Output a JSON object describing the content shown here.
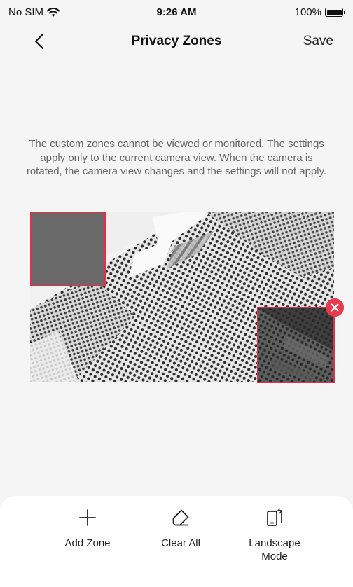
{
  "status_bar": {
    "carrier": "No SIM",
    "time": "9:26 AM",
    "battery": "100%",
    "battery_level": 1.0,
    "icons": [
      "wifi-icon",
      "battery-icon"
    ]
  },
  "nav": {
    "title": "Privacy Zones",
    "save_label": "Save",
    "back_icon": "chevron-left-icon"
  },
  "description": "The custom zones cannot be viewed or monitored. The settings apply only to the current camera view. When the camera is rotated, the camera view changes and the settings will not apply.",
  "camera": {
    "zones": [
      "privacy-zone-1",
      "privacy-zone-2"
    ],
    "delete_icon": "close-icon",
    "colors": {
      "zone_border": "#e0304b",
      "delete_button": "#e8394d"
    }
  },
  "actions": {
    "add_zone": {
      "label": "Add Zone",
      "icon": "plus-icon"
    },
    "clear_all": {
      "label": "Clear All",
      "icon": "eraser-icon"
    },
    "landscape_mode": {
      "label": "Landscape Mode",
      "icon": "landscape-icon"
    }
  }
}
